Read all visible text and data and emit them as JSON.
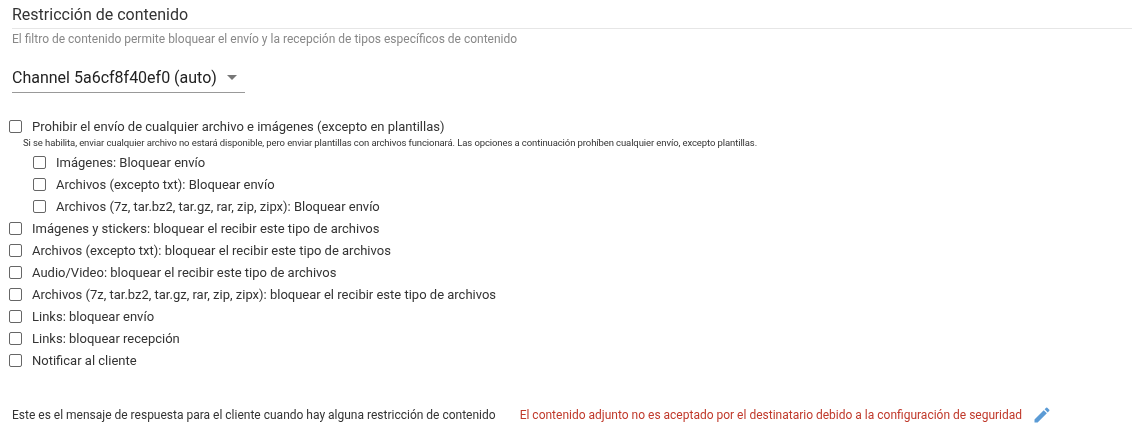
{
  "section": {
    "title": "Restricción de contenido",
    "subtitle": "El filtro de contenido permite bloquear el envío y la recepción de tipos específicos de contenido"
  },
  "channel_select": {
    "value": "Channel 5a6cf8f40ef0 (auto)"
  },
  "options": [
    {
      "label": "Prohibir el envío de cualquier archivo e imágenes (excepto en plantillas)",
      "checked": false,
      "note": "Si se habilita, enviar cualquier archivo no estará disponible, pero enviar plantillas con archivos funcionará. Las opciones a continuación prohíben cualquier envío, excepto plantillas.",
      "children": [
        {
          "label": "Imágenes: Bloquear envío",
          "checked": false
        },
        {
          "label": "Archivos (excepto txt): Bloquear envío",
          "checked": false
        },
        {
          "label": "Archivos (7z, tar.bz2, tar.gz, rar, zip, zipx): Bloquear envío",
          "checked": false
        }
      ]
    },
    {
      "label": "Imágenes y stickers: bloquear el recibir este tipo de archivos",
      "checked": false
    },
    {
      "label": "Archivos (excepto txt): bloquear el recibir este tipo de archivos",
      "checked": false
    },
    {
      "label": "Audio/Video: bloquear el recibir este tipo de archivos",
      "checked": false
    },
    {
      "label": "Archivos (7z, tar.bz2, tar.gz, rar, zip, zipx): bloquear el recibir este tipo de archivos",
      "checked": false
    },
    {
      "label": "Links: bloquear envío",
      "checked": false
    },
    {
      "label": "Links: bloquear recepción",
      "checked": false
    },
    {
      "label": "Notificar al cliente",
      "checked": false
    }
  ],
  "response_message": {
    "label": "Este es el mensaje de respuesta para el cliente cuando hay alguna restricción de contenido",
    "value": "El contenido adjunto no es aceptado por el destinatario debido a la configuración de seguridad"
  }
}
